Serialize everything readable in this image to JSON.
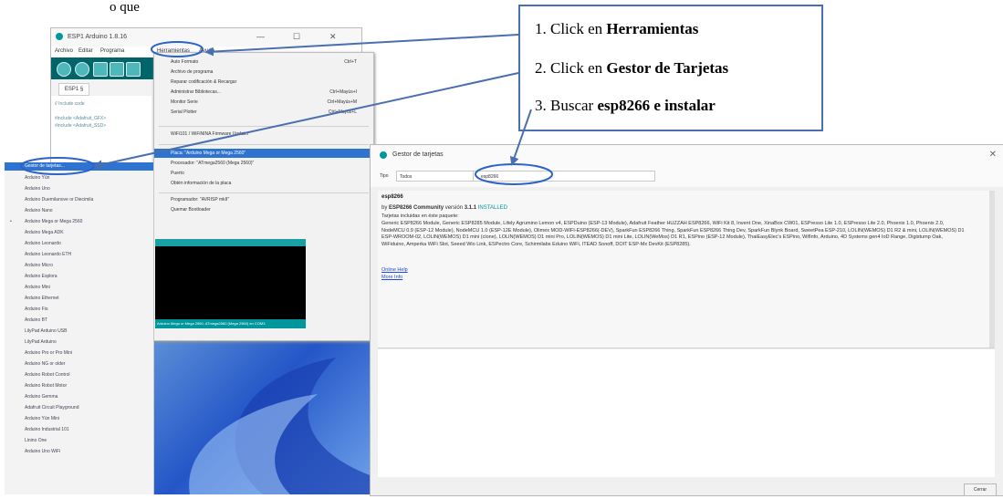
{
  "caption": "o que",
  "ide": {
    "title": "ESP1 Arduino 1.8.16",
    "menus": [
      "Archivo",
      "Editar",
      "Programa",
      "Herramientas",
      "Ayuda"
    ],
    "tab": "ESP1 §",
    "code_lines": [
      "// Include code",
      "#include <Adafruit_GFX>",
      "#include <Adafruit_SSD>"
    ],
    "tools_menu": {
      "items": [
        {
          "label": "Auto Formato",
          "shortcut": "Ctrl+T"
        },
        {
          "label": "Archivo de programa",
          "shortcut": ""
        },
        {
          "label": "Reparar codificación & Recargar",
          "shortcut": ""
        },
        {
          "label": "Administrar Bibliotecas...",
          "shortcut": "Ctrl+Mayús+I"
        },
        {
          "label": "Monitor Serie",
          "shortcut": "Ctrl+Mayús+M"
        },
        {
          "label": "Serial Plotter",
          "shortcut": "Ctrl+Mayús+L"
        },
        {
          "label": "WiFi101 / WiFiNINA Firmware Updater",
          "shortcut": ""
        },
        {
          "label": "Placa: \"Arduino Mega or Mega 2560\"",
          "shortcut": ""
        },
        {
          "label": "Procesador: \"ATmega2560 (Mega 2560)\"",
          "shortcut": ""
        },
        {
          "label": "Puerto",
          "shortcut": ""
        },
        {
          "label": "Obtén información de la placa",
          "shortcut": ""
        },
        {
          "label": "Programador: \"AVRISP mkII\"",
          "shortcut": ""
        },
        {
          "label": "Quemar Bootloader",
          "shortcut": ""
        }
      ]
    },
    "footer": "Arduino Mega or Mega 2560, ATmega2560 (Mega 2560) en COM3"
  },
  "boards": {
    "highlighted": "Gestor de tarjetas...",
    "items": [
      "Arduino Yún",
      "Arduino Uno",
      "Arduino Duemilanove or Diecimila",
      "Arduino Nano",
      "Arduino Mega or Mega 2560",
      "Arduino Mega ADK",
      "Arduino Leonardo",
      "Arduino Leonardo ETH",
      "Arduino Micro",
      "Arduino Esplora",
      "Arduino Mini",
      "Arduino Ethernet",
      "Arduino Fio",
      "Arduino BT",
      "LilyPad Arduino USB",
      "LilyPad Arduino",
      "Arduino Pro or Pro Mini",
      "Arduino NG or older",
      "Arduino Robot Control",
      "Arduino Robot Motor",
      "Arduino Gemma",
      "Adafruit Circuit Playground",
      "Arduino Yún Mini",
      "Arduino Industrial 101",
      "Linino One",
      "Arduino Uno WiFi"
    ]
  },
  "gestor": {
    "title": "Gestor de tarjetas",
    "type_label": "Tipo",
    "type_value": "Todos",
    "search_value": "esp8266",
    "package_name": "esp8266",
    "by_prefix": "by",
    "author": "ESP8266 Community",
    "version_label": "versión",
    "version": "3.1.1",
    "installed": "INSTALLED",
    "included_label": "Tarjetas incluidas en éste paquete:",
    "description": "Generic ESP8266 Module, Generic ESP8285 Module, Lifely Agrumino Lemon v4, ESPDuino (ESP-13 Module), Adafruit Feather HUZZAH ESP8266, WiFi Kit 8, Invent One, XinaBox CW01, ESPresso Lite 1.0, ESPresso Lite 2.0, Phoenix 1.0, Phoenix 2.0, NodeMCU 0.9 (ESP-12 Module), NodeMCU 1.0 (ESP-12E Module), Olimex MOD-WIFI-ESP8266(-DEV), SparkFun ESP8266 Thing, SparkFun ESP8266 Thing Dev, SparkFun Blynk Board, SweetPea ESP-210, LOLIN(WEMOS) D1 R2 & mini, LOLIN(WEMOS) D1 ESP-WROOM-02, LOLIN(WEMOS) D1 mini (clone), LOLIN(WEMOS) D1 mini Pro, LOLIN(WEMOS) D1 mini Lite, LOLIN(WeMos) D1 R1, ESPino (ESP-12 Module), ThaiEasyElec's ESPino, WifInfo, Arduino, 4D Systems gen4 IoD Range, Digistump Oak, WiFiduino, Amperka WiFi Slot, Seeed Wio Link, ESPectro Core, Schirmilabs Eduino WiFi, ITEAD Sonoff, DOIT ESP-Mx DevKit (ESP8285).",
    "online_help": "Online Help",
    "more_info": "More Info",
    "close_button": "Cerrar"
  },
  "instructions": {
    "step1_prefix": "1. Click en",
    "step1_bold": "Herramientas",
    "step2_prefix": "2. Click en",
    "step2_bold": "Gestor de Tarjetas",
    "step3_prefix": "3. Buscar",
    "step3_bold": "esp8266 e instalar"
  },
  "colors": {
    "arrow": "#4a6fb0",
    "highlight_ellipse": "#2b63c9",
    "ide_teal": "#00979c",
    "menu_highlight": "#2e73cf"
  }
}
